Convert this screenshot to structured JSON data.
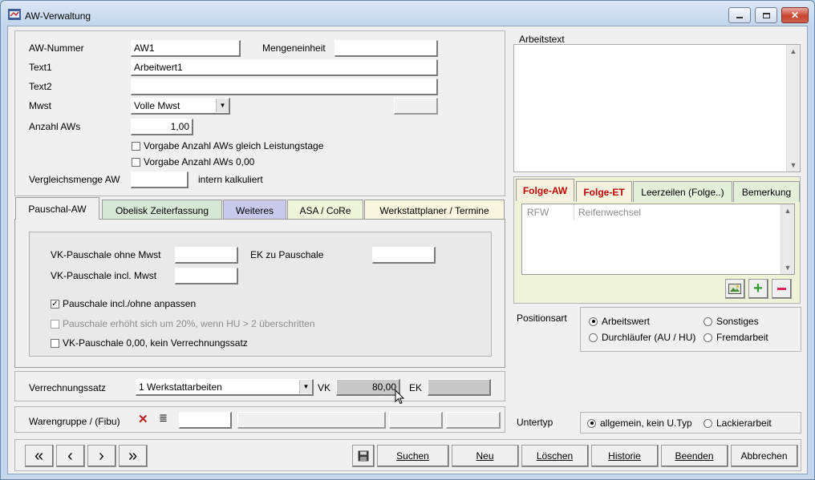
{
  "window": {
    "title": "AW-Verwaltung"
  },
  "form": {
    "aw_nummer_label": "AW-Nummer",
    "aw_nummer_value": "AW1",
    "mengeneinheit_label": "Mengeneinheit",
    "mengeneinheit_value": "",
    "text1_label": "Text1",
    "text1_value": "Arbeitwert1",
    "text2_label": "Text2",
    "text2_value": "",
    "mwst_label": "Mwst",
    "mwst_value": "Volle Mwst",
    "anzahl_label": "Anzahl AWs",
    "anzahl_value": "1,00",
    "chk_leistungstage": "Vorgabe Anzahl AWs gleich Leistungstage",
    "chk_null": "Vorgabe Anzahl AWs 0,00",
    "vergleich_label": "Vergleichsmenge AW",
    "vergleich_value": "",
    "intern_label": "intern kalkuliert"
  },
  "arbeitstext": {
    "label": "Arbeitstext",
    "value": ""
  },
  "tabs": [
    {
      "label": "Pauschal-AW"
    },
    {
      "label": "Obelisk Zeiterfassung"
    },
    {
      "label": "Weiteres"
    },
    {
      "label": "ASA / CoRe"
    },
    {
      "label": "Werkstattplaner / Termine"
    }
  ],
  "pauschal": {
    "vk_ohne_label": "VK-Pauschale ohne Mwst",
    "vk_ohne_value": "",
    "ek_label": "EK zu Pauschale",
    "ek_value": "",
    "vk_incl_label": "VK-Pauschale incl. Mwst",
    "vk_incl_value": "",
    "chk_anpassen": "Pauschale incl./ohne anpassen",
    "chk_hu": "Pauschale erhöht sich um 20%, wenn HU > 2 überschritten",
    "chk_vk_null": "VK-Pauschale 0,00, kein Verrechnungssatz"
  },
  "verrechnung": {
    "label": "Verrechnungssatz",
    "value": "1 Werkstattarbeiten",
    "vk_label": "VK",
    "vk_value": "80,00",
    "ek_label": "EK",
    "ek_value": ""
  },
  "warengruppe": {
    "label": "Warengruppe / (Fibu)"
  },
  "folge_tabs": [
    {
      "label": "Folge-AW"
    },
    {
      "label": "Folge-ET"
    },
    {
      "label": "Leerzeilen (Folge..)"
    },
    {
      "label": "Bemerkung"
    }
  ],
  "folge_rows": [
    {
      "code": "RFW",
      "text": "Reifenwechsel"
    }
  ],
  "positionsart": {
    "label": "Positionsart",
    "options": [
      {
        "label": "Arbeitswert",
        "selected": true
      },
      {
        "label": "Sonstiges",
        "selected": false
      },
      {
        "label": "Durchläufer (AU / HU)",
        "selected": false
      },
      {
        "label": "Fremdarbeit",
        "selected": false
      }
    ]
  },
  "untertyp": {
    "label": "Untertyp",
    "options": [
      {
        "label": "allgemein, kein U.Typ",
        "selected": true
      },
      {
        "label": "Lackierarbeit",
        "selected": false
      }
    ]
  },
  "buttons": {
    "suchen": "Suchen",
    "neu": "Neu",
    "loeschen": "Löschen",
    "historie": "Historie",
    "beenden": "Beenden",
    "abbrechen": "Abbrechen"
  },
  "colors": {
    "tab_obelisk": "#d6e7d6",
    "tab_weiteres": "#c9c9ec",
    "tab_asa": "#eef6d9",
    "tab_werkstatt": "#fbf6df",
    "folge_active": "#c00000",
    "green_plus": "#2f9c2f",
    "red_minus": "#d9265b"
  }
}
